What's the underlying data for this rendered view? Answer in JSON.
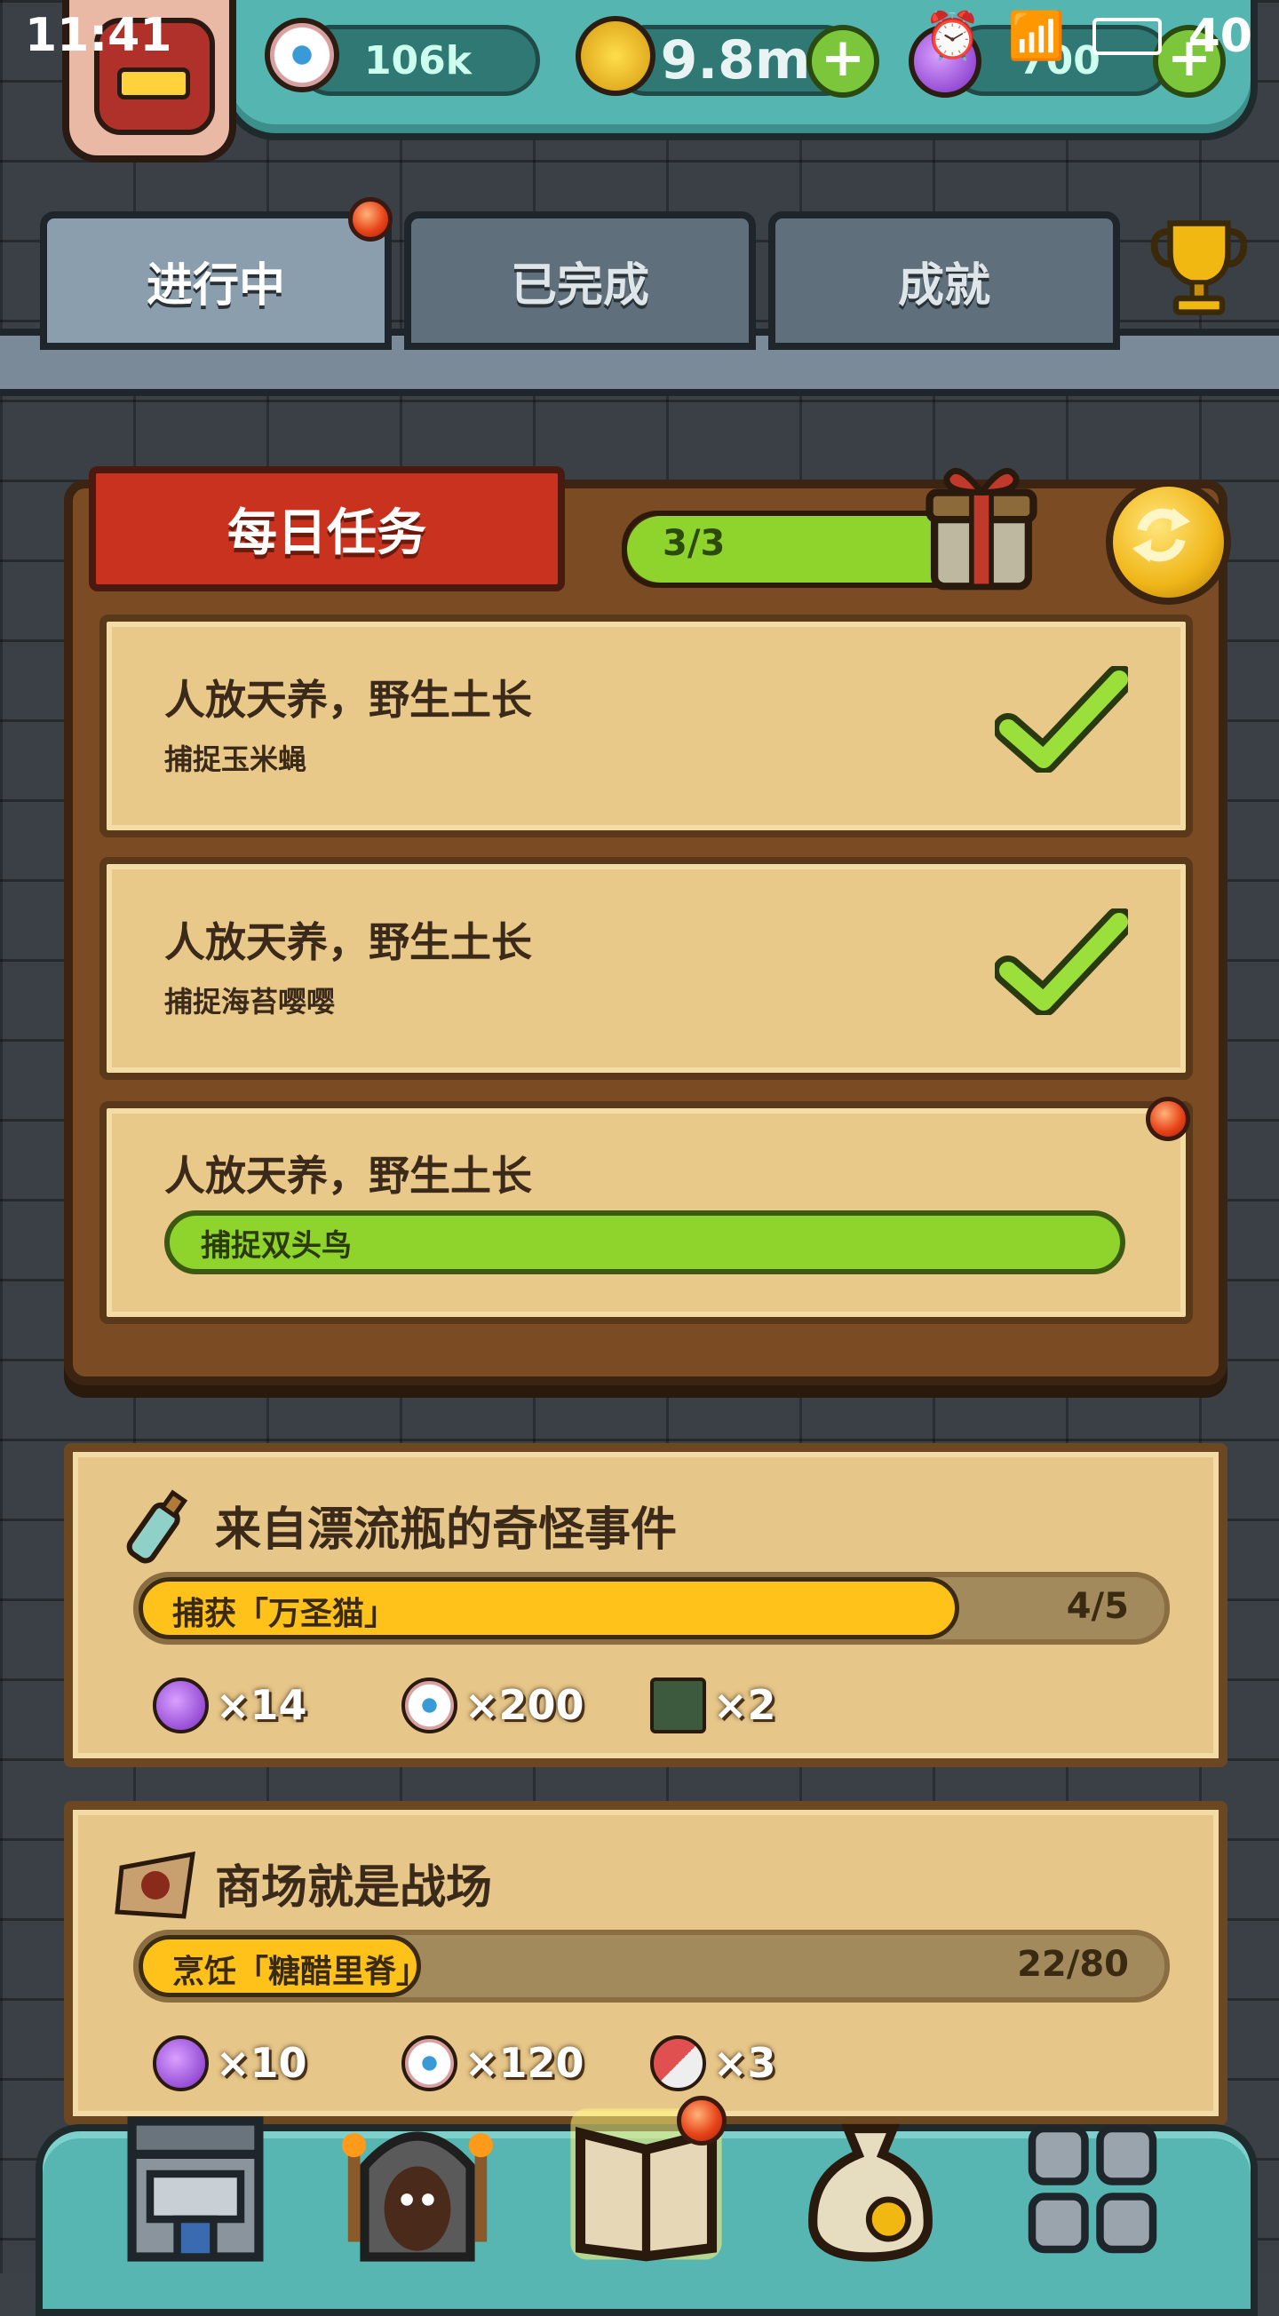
{
  "status_bar": {
    "time": "11:41",
    "battery": "40"
  },
  "currencies": {
    "eyes": "106k",
    "coins": "9.8m",
    "potions": "700"
  },
  "tabs": [
    {
      "label": "进行中",
      "active": true,
      "badge": true
    },
    {
      "label": "已完成",
      "active": false,
      "badge": false
    },
    {
      "label": "成就",
      "active": false,
      "badge": false
    }
  ],
  "daily": {
    "title": "每日任务",
    "progress_label": "3/3",
    "progress": 1.0,
    "tasks": [
      {
        "title": "人放天养，野生土长",
        "subtitle": "捕捉玉米蝇",
        "done": true
      },
      {
        "title": "人放天养，野生土长",
        "subtitle": "捕捉海苔嘤嘤",
        "done": true
      },
      {
        "title": "人放天养，野生土长",
        "subtitle": "捕捉双头鸟",
        "done": false,
        "progress": 1.0
      }
    ]
  },
  "quests": [
    {
      "title": "来自漂流瓶的奇怪事件",
      "icon": "bottle-icon",
      "task": "捕获「万圣猫」",
      "count": "4/5",
      "progress": 0.8,
      "rewards": [
        {
          "icon": "potion-icon",
          "amount": "×14"
        },
        {
          "icon": "eye-icon",
          "amount": "×200"
        },
        {
          "icon": "blueprint-icon",
          "amount": "×2"
        }
      ]
    },
    {
      "title": "商场就是战场",
      "icon": "map-icon",
      "task": "烹饪「糖醋里脊」",
      "count": "22/80",
      "progress": 0.275,
      "rewards": [
        {
          "icon": "potion-icon",
          "amount": "×10"
        },
        {
          "icon": "eye-icon",
          "amount": "×120"
        },
        {
          "icon": "capsule-icon",
          "amount": "×3"
        }
      ]
    }
  ],
  "nav": [
    {
      "name": "shop-nav",
      "icon": "building-icon"
    },
    {
      "name": "dungeon-nav",
      "icon": "monster-gate-icon"
    },
    {
      "name": "quest-book-nav",
      "icon": "book-icon",
      "active": true,
      "badge": true
    },
    {
      "name": "bag-nav",
      "icon": "sack-icon"
    },
    {
      "name": "grid-nav",
      "icon": "grid-icon"
    }
  ],
  "colors": {
    "accent_green": "#8fd42c",
    "accent_yellow": "#ffc21a",
    "badge_red": "#e8451a",
    "panel_brown": "#7b4c24"
  }
}
